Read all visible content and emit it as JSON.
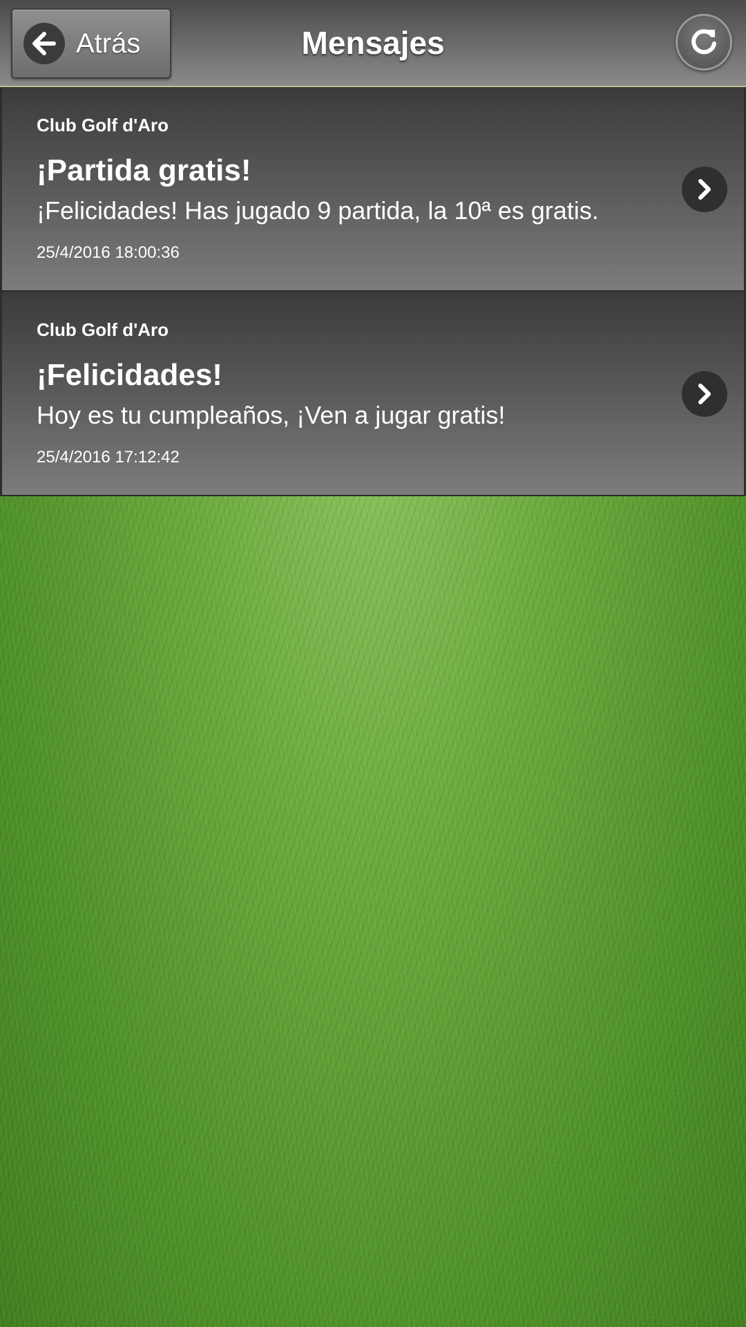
{
  "header": {
    "back_label": "Atrás",
    "title": "Mensajes"
  },
  "messages": [
    {
      "sender": "Club Golf d'Aro",
      "title": "¡Partida gratis!",
      "body": "¡Felicidades! Has jugado 9 partida, la 10ª es gratis.",
      "date": "25/4/2016 18:00:36"
    },
    {
      "sender": "Club Golf d'Aro",
      "title": "¡Felicidades!",
      "body": "Hoy es tu cumpleaños, ¡Ven a jugar gratis!",
      "date": "25/4/2016 17:12:42"
    }
  ],
  "colors": {
    "header_bg": "#6e6e6e",
    "item_bg": "#5a5a5a",
    "text": "#ffffff",
    "grass": "#6aa93d"
  }
}
